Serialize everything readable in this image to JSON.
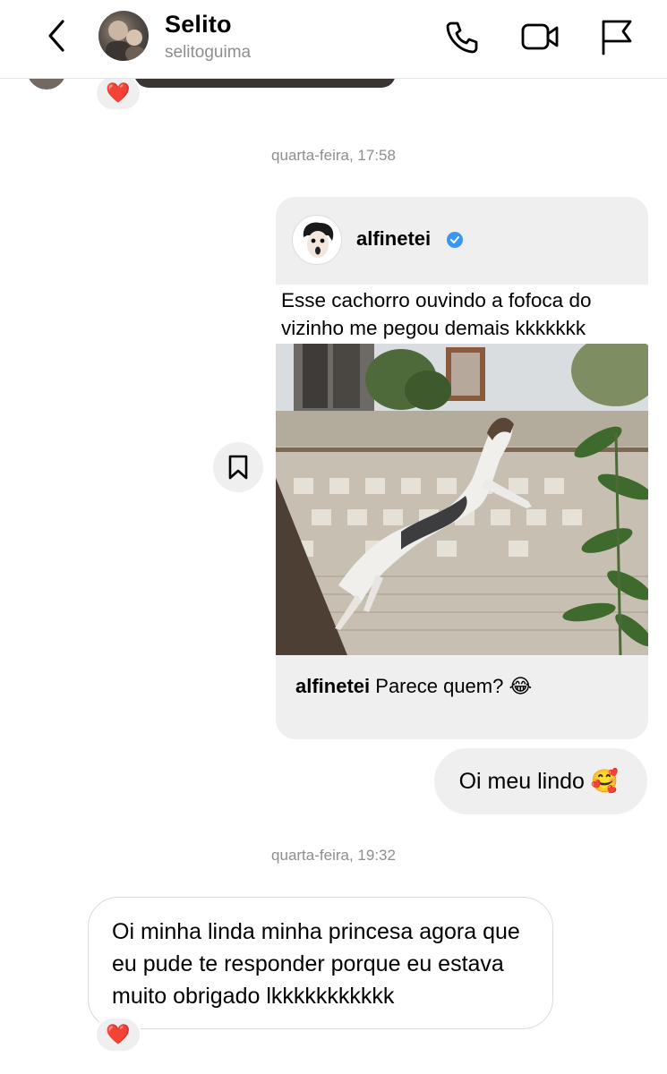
{
  "header": {
    "name": "Selito",
    "username": "selitoguima",
    "icons": [
      "back-arrow-icon",
      "phone-icon",
      "video-call-icon",
      "flag-icon"
    ]
  },
  "previous_message": {
    "reaction": "❤️"
  },
  "timestamps": {
    "first": "quarta-feira, 17:58",
    "second": "quarta-feira, 19:32"
  },
  "shared_post": {
    "author": "alfinetei",
    "verified": true,
    "caption_overlay": "Esse cachorro ouvindo a fofoca do\nvizinho me pegou demais kkkkkkk",
    "footer_author": "alfinetei",
    "footer_text": "Parece quem? 😂"
  },
  "messages": {
    "outgoing": "Oi meu lindo 🥰",
    "incoming": "Oi minha linda minha princesa agora que eu pude te responder porque eu estava muito obrigado lkkkkkkkkkkk",
    "incoming_reaction": "❤️"
  },
  "colors": {
    "bubble_gray": "#efefef",
    "secondary_text": "#8e8e8e",
    "verified_blue": "#3897f0",
    "heart_red": "#e0245e"
  }
}
